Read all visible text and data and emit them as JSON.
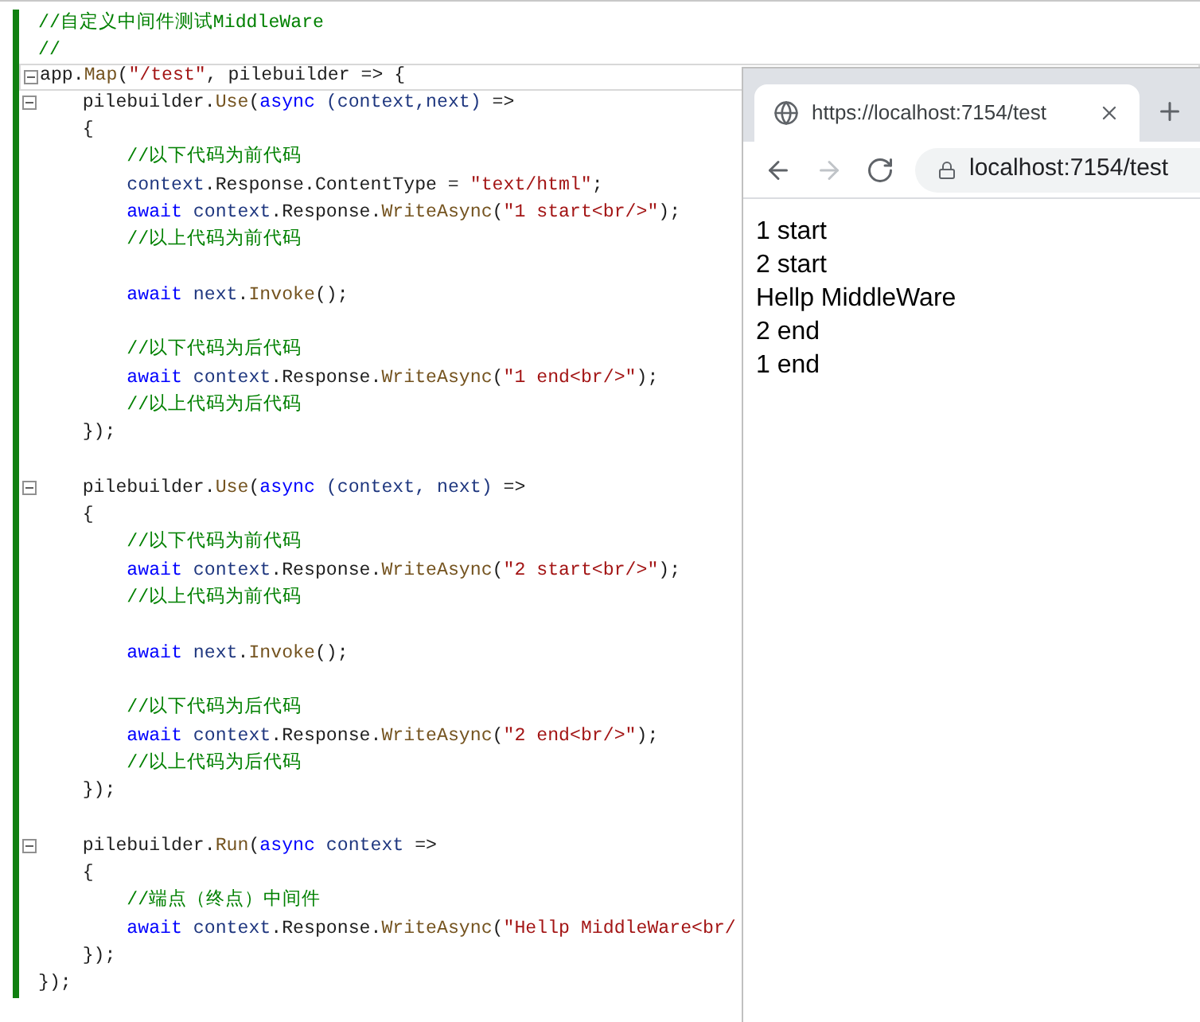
{
  "editor": {
    "lines": [
      {
        "fold": false,
        "current": false,
        "tokens": [
          {
            "kind": "comment",
            "text": "//自定义中间件测试MiddleWare"
          }
        ]
      },
      {
        "fold": false,
        "current": false,
        "tokens": [
          {
            "kind": "comment",
            "text": "//"
          }
        ]
      },
      {
        "fold": true,
        "current": true,
        "tokens": [
          {
            "kind": "plain",
            "text": "app."
          },
          {
            "kind": "method",
            "text": "Map"
          },
          {
            "kind": "plain",
            "text": "("
          },
          {
            "kind": "string",
            "text": "\"/test\""
          },
          {
            "kind": "plain",
            "text": ", pilebuilder => {"
          }
        ]
      },
      {
        "fold": true,
        "current": false,
        "tokens": [
          {
            "kind": "plain",
            "text": "    pilebuilder."
          },
          {
            "kind": "method",
            "text": "Use"
          },
          {
            "kind": "plain",
            "text": "("
          },
          {
            "kind": "keyword",
            "text": "async"
          },
          {
            "kind": "param",
            "text": " (context,next)"
          },
          {
            "kind": "plain",
            "text": " =>"
          }
        ]
      },
      {
        "fold": false,
        "current": false,
        "tokens": [
          {
            "kind": "plain",
            "text": "    {"
          }
        ]
      },
      {
        "fold": false,
        "current": false,
        "tokens": [
          {
            "kind": "comment",
            "text": "        //以下代码为前代码"
          }
        ]
      },
      {
        "fold": false,
        "current": false,
        "tokens": [
          {
            "kind": "param",
            "text": "        context"
          },
          {
            "kind": "plain",
            "text": ".Response.ContentType = "
          },
          {
            "kind": "string",
            "text": "\"text/html\""
          },
          {
            "kind": "plain",
            "text": ";"
          }
        ]
      },
      {
        "fold": false,
        "current": false,
        "tokens": [
          {
            "kind": "keyword",
            "text": "        await"
          },
          {
            "kind": "param",
            "text": " context"
          },
          {
            "kind": "plain",
            "text": ".Response."
          },
          {
            "kind": "method",
            "text": "WriteAsync"
          },
          {
            "kind": "plain",
            "text": "("
          },
          {
            "kind": "string",
            "text": "\"1 start<br/>\""
          },
          {
            "kind": "plain",
            "text": ");"
          }
        ]
      },
      {
        "fold": false,
        "current": false,
        "tokens": [
          {
            "kind": "comment",
            "text": "        //以上代码为前代码"
          }
        ]
      },
      {
        "fold": false,
        "current": false
      },
      {
        "fold": false,
        "current": false,
        "tokens": [
          {
            "kind": "keyword",
            "text": "        await"
          },
          {
            "kind": "param",
            "text": " next"
          },
          {
            "kind": "plain",
            "text": "."
          },
          {
            "kind": "method",
            "text": "Invoke"
          },
          {
            "kind": "plain",
            "text": "();"
          }
        ]
      },
      {
        "fold": false,
        "current": false
      },
      {
        "fold": false,
        "current": false,
        "tokens": [
          {
            "kind": "comment",
            "text": "        //以下代码为后代码"
          }
        ]
      },
      {
        "fold": false,
        "current": false,
        "tokens": [
          {
            "kind": "keyword",
            "text": "        await"
          },
          {
            "kind": "param",
            "text": " context"
          },
          {
            "kind": "plain",
            "text": ".Response."
          },
          {
            "kind": "method",
            "text": "WriteAsync"
          },
          {
            "kind": "plain",
            "text": "("
          },
          {
            "kind": "string",
            "text": "\"1 end<br/>\""
          },
          {
            "kind": "plain",
            "text": ");"
          }
        ]
      },
      {
        "fold": false,
        "current": false,
        "tokens": [
          {
            "kind": "comment",
            "text": "        //以上代码为后代码"
          }
        ]
      },
      {
        "fold": false,
        "current": false,
        "tokens": [
          {
            "kind": "plain",
            "text": "    });"
          }
        ]
      },
      {
        "fold": false,
        "current": false
      },
      {
        "fold": true,
        "current": false,
        "tokens": [
          {
            "kind": "plain",
            "text": "    pilebuilder."
          },
          {
            "kind": "method",
            "text": "Use"
          },
          {
            "kind": "plain",
            "text": "("
          },
          {
            "kind": "keyword",
            "text": "async"
          },
          {
            "kind": "param",
            "text": " (context, next)"
          },
          {
            "kind": "plain",
            "text": " =>"
          }
        ]
      },
      {
        "fold": false,
        "current": false,
        "tokens": [
          {
            "kind": "plain",
            "text": "    {"
          }
        ]
      },
      {
        "fold": false,
        "current": false,
        "tokens": [
          {
            "kind": "comment",
            "text": "        //以下代码为前代码"
          }
        ]
      },
      {
        "fold": false,
        "current": false,
        "tokens": [
          {
            "kind": "keyword",
            "text": "        await"
          },
          {
            "kind": "param",
            "text": " context"
          },
          {
            "kind": "plain",
            "text": ".Response."
          },
          {
            "kind": "method",
            "text": "WriteAsync"
          },
          {
            "kind": "plain",
            "text": "("
          },
          {
            "kind": "string",
            "text": "\"2 start<br/>\""
          },
          {
            "kind": "plain",
            "text": ");"
          }
        ]
      },
      {
        "fold": false,
        "current": false,
        "tokens": [
          {
            "kind": "comment",
            "text": "        //以上代码为前代码"
          }
        ]
      },
      {
        "fold": false,
        "current": false
      },
      {
        "fold": false,
        "current": false,
        "tokens": [
          {
            "kind": "keyword",
            "text": "        await"
          },
          {
            "kind": "param",
            "text": " next"
          },
          {
            "kind": "plain",
            "text": "."
          },
          {
            "kind": "method",
            "text": "Invoke"
          },
          {
            "kind": "plain",
            "text": "();"
          }
        ]
      },
      {
        "fold": false,
        "current": false
      },
      {
        "fold": false,
        "current": false,
        "tokens": [
          {
            "kind": "comment",
            "text": "        //以下代码为后代码"
          }
        ]
      },
      {
        "fold": false,
        "current": false,
        "tokens": [
          {
            "kind": "keyword",
            "text": "        await"
          },
          {
            "kind": "param",
            "text": " context"
          },
          {
            "kind": "plain",
            "text": ".Response."
          },
          {
            "kind": "method",
            "text": "WriteAsync"
          },
          {
            "kind": "plain",
            "text": "("
          },
          {
            "kind": "string",
            "text": "\"2 end<br/>\""
          },
          {
            "kind": "plain",
            "text": ");"
          }
        ]
      },
      {
        "fold": false,
        "current": false,
        "tokens": [
          {
            "kind": "comment",
            "text": "        //以上代码为后代码"
          }
        ]
      },
      {
        "fold": false,
        "current": false,
        "tokens": [
          {
            "kind": "plain",
            "text": "    });"
          }
        ]
      },
      {
        "fold": false,
        "current": false
      },
      {
        "fold": true,
        "current": false,
        "tokens": [
          {
            "kind": "plain",
            "text": "    pilebuilder."
          },
          {
            "kind": "method",
            "text": "Run"
          },
          {
            "kind": "plain",
            "text": "("
          },
          {
            "kind": "keyword",
            "text": "async"
          },
          {
            "kind": "param",
            "text": " context"
          },
          {
            "kind": "plain",
            "text": " =>"
          }
        ]
      },
      {
        "fold": false,
        "current": false,
        "tokens": [
          {
            "kind": "plain",
            "text": "    {"
          }
        ]
      },
      {
        "fold": false,
        "current": false,
        "tokens": [
          {
            "kind": "comment",
            "text": "        //端点（终点）中间件"
          }
        ]
      },
      {
        "fold": false,
        "current": false,
        "tokens": [
          {
            "kind": "keyword",
            "text": "        await"
          },
          {
            "kind": "param",
            "text": " context"
          },
          {
            "kind": "plain",
            "text": ".Response."
          },
          {
            "kind": "method",
            "text": "WriteAsync"
          },
          {
            "kind": "plain",
            "text": "("
          },
          {
            "kind": "string",
            "text": "\"Hellp MiddleWare<br/"
          }
        ]
      },
      {
        "fold": false,
        "current": false,
        "tokens": [
          {
            "kind": "plain",
            "text": "    });"
          }
        ]
      },
      {
        "fold": false,
        "current": false,
        "tokens": [
          {
            "kind": "plain",
            "text": "});"
          }
        ]
      }
    ]
  },
  "browser": {
    "tab": {
      "title": "https://localhost:7154/test"
    },
    "nav": [
      {
        "kind": "back",
        "disabled": false
      },
      {
        "kind": "forward",
        "disabled": true
      },
      {
        "kind": "reload",
        "disabled": false
      }
    ],
    "address": "localhost:7154/test",
    "content": [
      "1 start",
      "2 start",
      "Hellp MiddleWare",
      "2 end",
      "1 end"
    ]
  }
}
